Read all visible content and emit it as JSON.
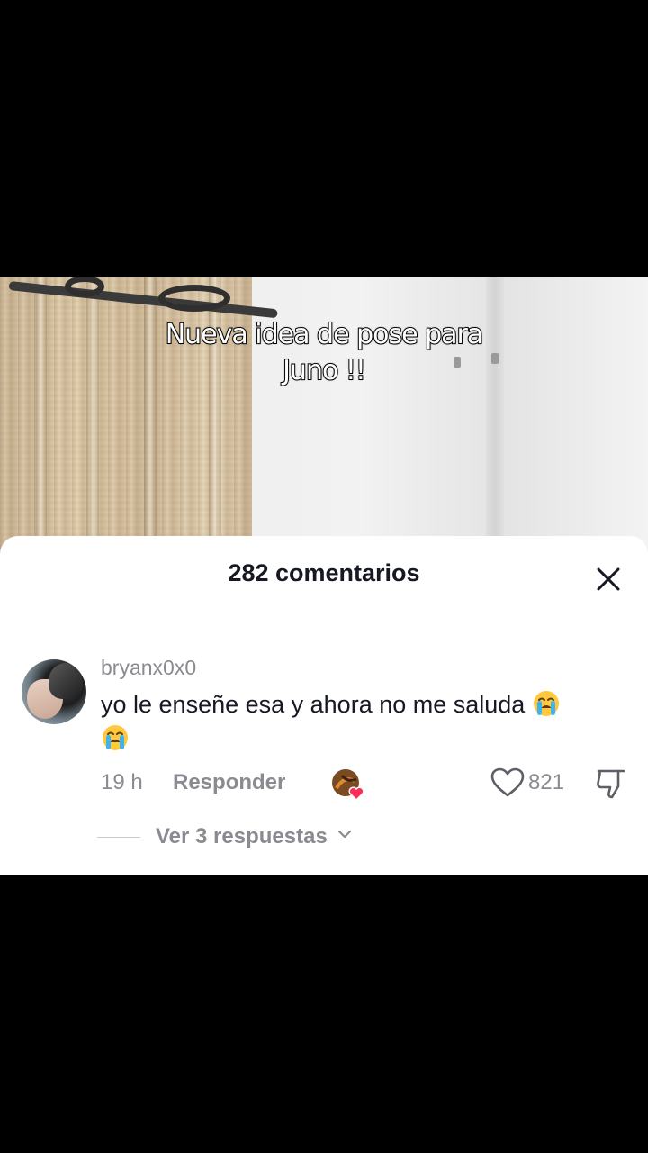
{
  "video": {
    "caption_lines": [
      "Nueva idea de pose para",
      "Juno !!"
    ]
  },
  "comments_sheet": {
    "title": "282 comentarios",
    "close_icon": "close-icon",
    "comment": {
      "username": "bryanx0x0",
      "text": "yo le enseñe esa y ahora no me saluda",
      "emoji": "loudly-crying-face",
      "time": "19 h",
      "reply_label": "Responder",
      "creator_liked_badge": "creator-liked-heart",
      "like_count": "821",
      "view_replies_label": "Ver 3 respuestas"
    }
  },
  "colors": {
    "primary_text": "#161823",
    "secondary_text": "#8a8b91",
    "sheet_bg": "#ffffff",
    "background": "#000000",
    "heart_pink": "#fe2c55"
  }
}
